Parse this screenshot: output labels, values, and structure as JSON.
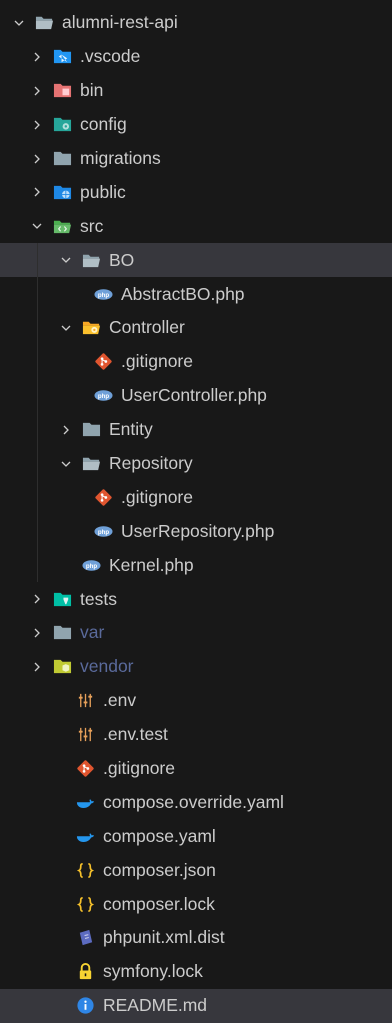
{
  "explorer": {
    "items": [
      {
        "label": "alumni-rest-api",
        "icon": "folder-open-icon"
      },
      {
        "label": ".vscode",
        "icon": "folder-vscode-icon"
      },
      {
        "label": "bin",
        "icon": "folder-bin-icon"
      },
      {
        "label": "config",
        "icon": "folder-config-icon"
      },
      {
        "label": "migrations",
        "icon": "folder-icon"
      },
      {
        "label": "public",
        "icon": "folder-public-icon"
      },
      {
        "label": "src",
        "icon": "folder-src-open-icon"
      },
      {
        "label": "BO",
        "icon": "folder-open-icon"
      },
      {
        "label": "AbstractBO.php",
        "icon": "php-file-icon"
      },
      {
        "label": "Controller",
        "icon": "folder-controller-open-icon"
      },
      {
        "label": ".gitignore",
        "icon": "git-file-icon"
      },
      {
        "label": "UserController.php",
        "icon": "php-file-icon"
      },
      {
        "label": "Entity",
        "icon": "folder-icon"
      },
      {
        "label": "Repository",
        "icon": "folder-open-icon"
      },
      {
        "label": ".gitignore",
        "icon": "git-file-icon"
      },
      {
        "label": "UserRepository.php",
        "icon": "php-file-icon"
      },
      {
        "label": "Kernel.php",
        "icon": "php-file-icon"
      },
      {
        "label": "tests",
        "icon": "folder-tests-icon"
      },
      {
        "label": "var",
        "icon": "folder-icon"
      },
      {
        "label": "vendor",
        "icon": "folder-vendor-icon"
      },
      {
        "label": ".env",
        "icon": "env-file-icon"
      },
      {
        "label": ".env.test",
        "icon": "env-file-icon"
      },
      {
        "label": ".gitignore",
        "icon": "git-file-icon"
      },
      {
        "label": "compose.override.yaml",
        "icon": "docker-icon"
      },
      {
        "label": "compose.yaml",
        "icon": "docker-icon"
      },
      {
        "label": "composer.json",
        "icon": "json-braces-icon"
      },
      {
        "label": "composer.lock",
        "icon": "json-braces-icon"
      },
      {
        "label": "phpunit.xml.dist",
        "icon": "phpunit-icon"
      },
      {
        "label": "symfony.lock",
        "icon": "lock-icon"
      },
      {
        "label": "README.md",
        "icon": "info-icon"
      }
    ]
  },
  "colors": {
    "background": "#181818",
    "selected_row": "#37373d",
    "text": "#cccccc",
    "ignored_text": "#5a6a9b",
    "php_icon": "#6fa0d8",
    "git_icon": "#e0552f",
    "docker_icon": "#2496ed",
    "json_icon": "#f5c02b",
    "lock_icon": "#f8d432",
    "info_icon": "#2f86e6"
  }
}
